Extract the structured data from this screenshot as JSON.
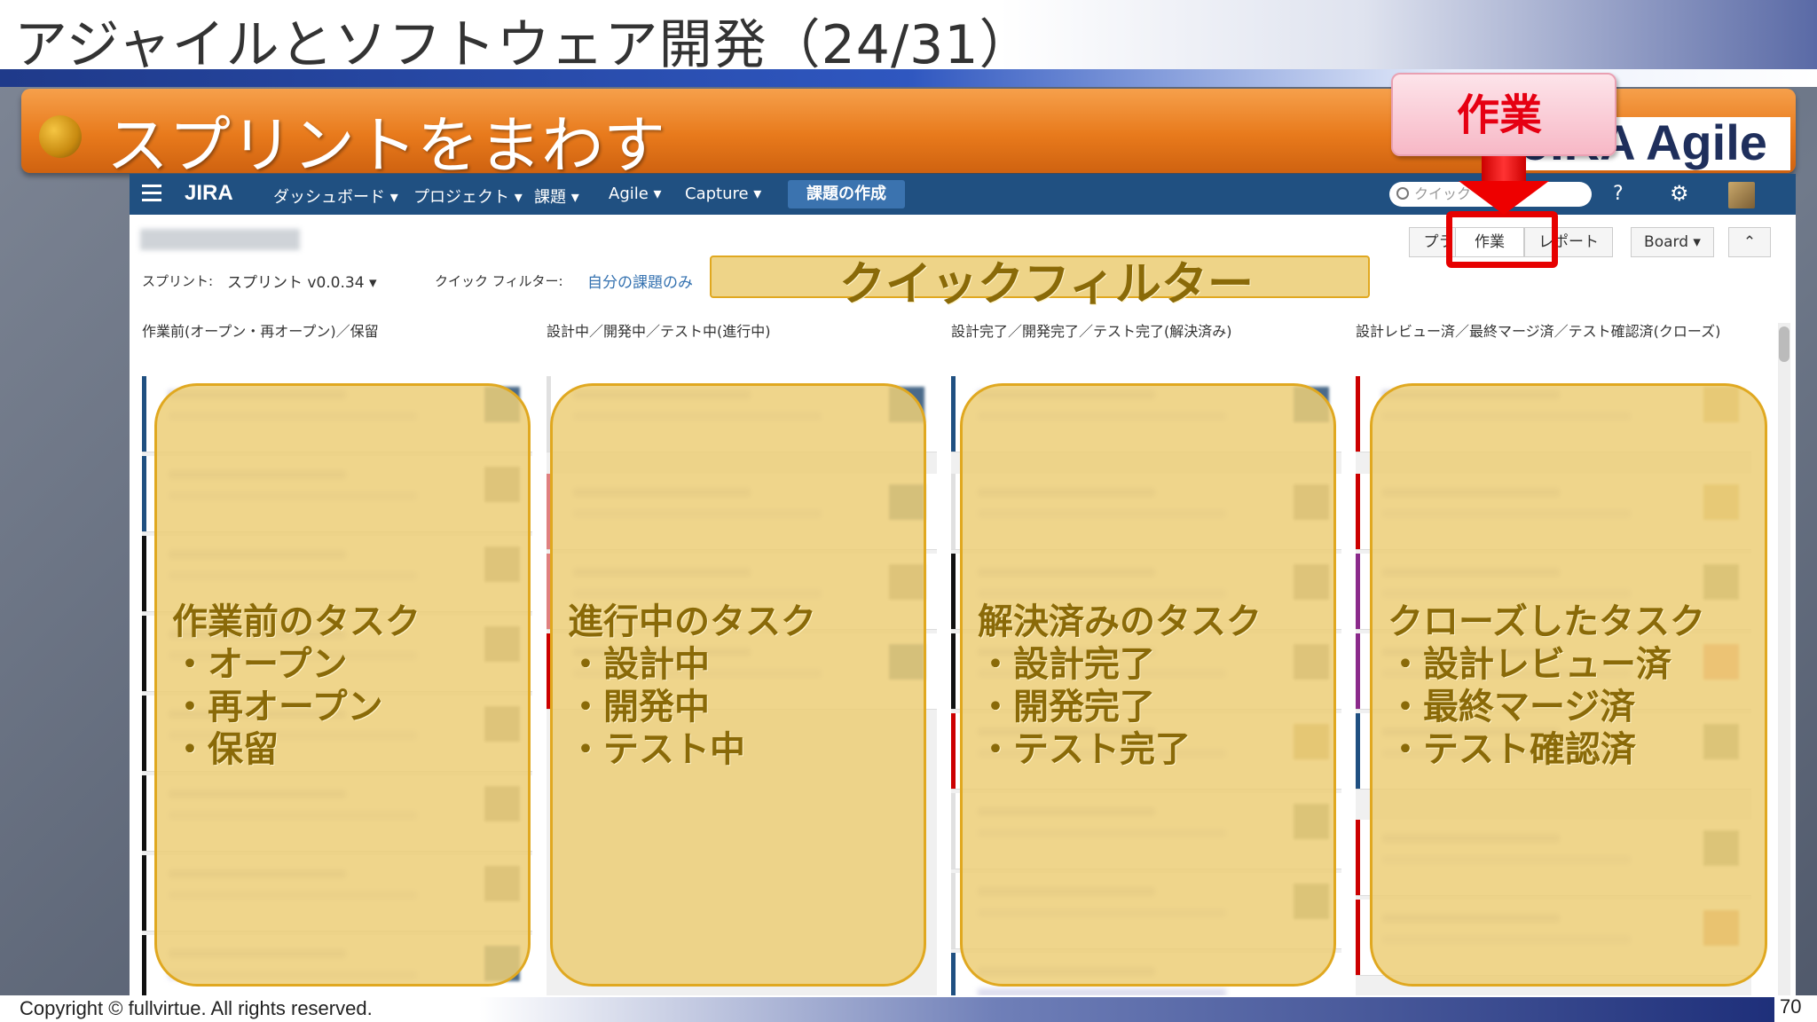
{
  "slide": {
    "title": "アジャイルとソフトウェア開発（24/31）",
    "section": "スプリントをまわす",
    "logo_text": "JIRA Agile",
    "callout": "作業",
    "copyright": "Copyright © fullvirtue.  All rights reserved.",
    "page": "70"
  },
  "jira": {
    "nav": {
      "logo": "JIRA",
      "items": [
        "ダッシュボード ▾",
        "プロジェクト ▾",
        "課題 ▾",
        "Agile ▾",
        "Capture ▾"
      ],
      "create": "課題の作成",
      "search_placeholder": "クイック",
      "help_icon": "?",
      "gear_icon": "⚙"
    },
    "sprint_label": "スプリント:",
    "sprint_value": "スプリント v0.0.34 ▾",
    "quick_filter_label": "クイック フィルター:",
    "quick_filter_mine": "自分の課題のみ",
    "quick_filter_callout": "クイックフィルター",
    "modes": {
      "plan": "プラン",
      "work": "作業",
      "report": "レポート",
      "board": "Board ▾",
      "collapse": "⌃"
    },
    "columns": [
      {
        "header": "作業前(オープン・再オープン)／保留"
      },
      {
        "header": "設計中／開発中／テスト中(進行中)"
      },
      {
        "header": "設計完了／開発完了／テスト完了(解決済み)"
      },
      {
        "header": "設計レビュー済／最終マージ済／テスト確認済(クローズ)"
      }
    ]
  },
  "overlays": [
    {
      "title": "作業前のタスク",
      "items": [
        "・オープン",
        "・再オープン",
        "・保留"
      ]
    },
    {
      "title": "進行中のタスク",
      "items": [
        "・設計中",
        "・開発中",
        "・テスト中"
      ]
    },
    {
      "title": "解決済みのタスク",
      "items": [
        "・設計完了",
        "・開発完了",
        "・テスト完了"
      ]
    },
    {
      "title": "クローズしたタスク",
      "items": [
        "・設計レビュー済",
        "・最終マージ済",
        "・テスト確認済"
      ]
    }
  ],
  "colors": {
    "jira_nav": "#205081",
    "banner_orange": "#e87a1c",
    "overlay_yellow": "#eccE78",
    "highlight_red": "#e60000"
  }
}
